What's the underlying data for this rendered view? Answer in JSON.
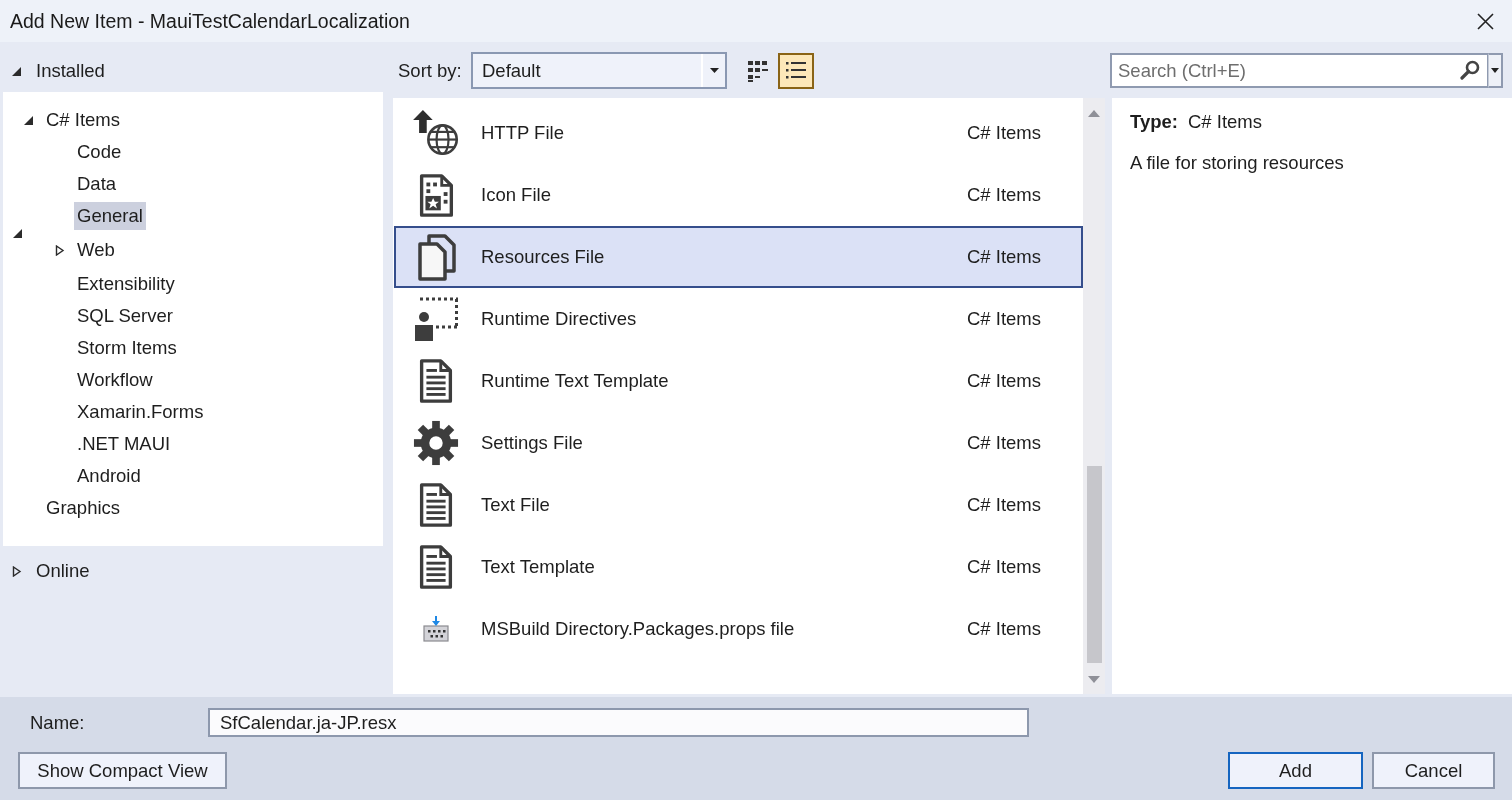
{
  "window": {
    "title": "Add New Item - MauiTestCalendarLocalization"
  },
  "sections": [
    {
      "label": "Installed",
      "expanded": true,
      "children": [
        {
          "label": "C# Items",
          "selected": false,
          "expanded": true,
          "children": [
            {
              "label": "Code",
              "selected": false
            },
            {
              "label": "Data",
              "selected": false
            },
            {
              "label": "General",
              "selected": true
            },
            {
              "label": "Web",
              "selected": false,
              "expanded": false,
              "stray_expander": true
            },
            {
              "label": "Extensibility",
              "selected": false
            },
            {
              "label": "SQL Server",
              "selected": false
            },
            {
              "label": "Storm Items",
              "selected": false
            },
            {
              "label": "Workflow",
              "selected": false
            },
            {
              "label": "Xamarin.Forms",
              "selected": false
            },
            {
              "label": ".NET MAUI",
              "selected": false
            },
            {
              "label": "Android",
              "selected": false
            }
          ]
        },
        {
          "label": "Graphics",
          "selected": false
        }
      ]
    },
    {
      "label": "Online",
      "expanded": false
    }
  ],
  "toolbar": {
    "sort_label": "Sort by:",
    "sort_value": "Default",
    "views": [
      {
        "kind": "grid",
        "selected": false
      },
      {
        "kind": "list",
        "selected": true
      }
    ]
  },
  "search": {
    "placeholder": "Search (Ctrl+E)"
  },
  "templates": [
    {
      "name": "HTTP File",
      "category": "C# Items",
      "kind": "http",
      "selected": false
    },
    {
      "name": "Icon File",
      "category": "C# Items",
      "kind": "icon",
      "selected": false
    },
    {
      "name": "Resources File",
      "category": "C# Items",
      "kind": "resources",
      "selected": true
    },
    {
      "name": "Runtime Directives",
      "category": "C# Items",
      "kind": "directives",
      "selected": false
    },
    {
      "name": "Runtime Text Template",
      "category": "C# Items",
      "kind": "text",
      "selected": false
    },
    {
      "name": "Settings File",
      "category": "C# Items",
      "kind": "settings",
      "selected": false
    },
    {
      "name": "Text File",
      "category": "C# Items",
      "kind": "text",
      "selected": false
    },
    {
      "name": "Text Template",
      "category": "C# Items",
      "kind": "text",
      "selected": false
    },
    {
      "name": "MSBuild Directory.Packages.props file",
      "category": "C# Items",
      "kind": "msbuild",
      "selected": false
    }
  ],
  "details": {
    "type_label": "Type:",
    "type_value": "C# Items",
    "description": "A file for storing resources"
  },
  "name_field": {
    "label": "Name:",
    "value": "SfCalendar.ja-JP.resx"
  },
  "compact_button": "Show Compact View",
  "buttons": [
    {
      "label": "Add",
      "default": true
    },
    {
      "label": "Cancel",
      "default": false
    }
  ]
}
